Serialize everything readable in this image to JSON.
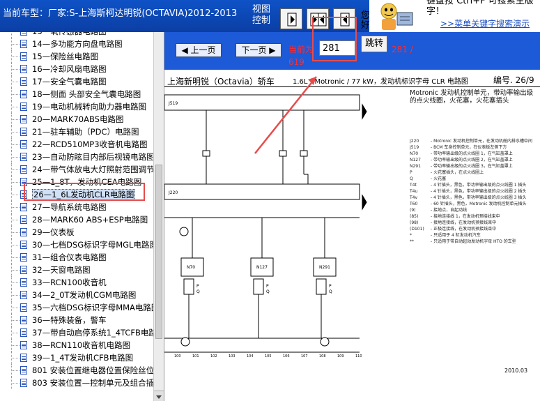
{
  "topbar": {
    "car_model": "当前车型：厂家:S-上海斯柯达明锐(OCTAVIA)2012-2013",
    "view_control_line1": "视图",
    "view_control_line2": "控制",
    "you_partial": "您好",
    "tip_line1": "键盘按   Ctrl+F   可搜索主版",
    "tip_line2": "字！",
    "tip_link": ">>菜单关键字搜索演示"
  },
  "sidebar": {
    "items": [
      {
        "label": "13—氧传感器电路图"
      },
      {
        "label": "14—多功能方向盘电路图"
      },
      {
        "label": "15—保险丝电路图"
      },
      {
        "label": "16—冷却风扇电路图"
      },
      {
        "label": "17—安全气囊电路图"
      },
      {
        "label": "18—侧面 头部安全气囊电路图"
      },
      {
        "label": "19—电动机械转向助力器电路图"
      },
      {
        "label": "20—MARK70ABS电路图"
      },
      {
        "label": "21—驻车辅助（PDC）电路图"
      },
      {
        "label": "22—RCD510MP3收音机电路图"
      },
      {
        "label": "23—自动防眩目内部后视镜电路图"
      },
      {
        "label": "24—带气体放电大灯照射范围调节"
      },
      {
        "label": "25—1_8T，发动机CEA电路图"
      },
      {
        "label": "26—1_6L发动机CLR电路图",
        "selected": true
      },
      {
        "label": "27—导航系统电路图"
      },
      {
        "label": "28—MARK60 ABS+ESP电路图"
      },
      {
        "label": "29—仪表板"
      },
      {
        "label": "30—七档DSG标识字母MGL电路图"
      },
      {
        "label": "31—组合仪表电路图"
      },
      {
        "label": "32—天窗电路图"
      },
      {
        "label": "33—RCN100收音机"
      },
      {
        "label": "34—2_0T发动机CGM电路图"
      },
      {
        "label": "35—六档DSG标识字母MMA电路图"
      },
      {
        "label": "36—特殊装备，警车"
      },
      {
        "label": "37—带自动启停系统1_4TCFB电路"
      },
      {
        "label": "38—RCN110收音机电路图"
      },
      {
        "label": "39—1_4T发动机CFB电路图"
      },
      {
        "label": "801 安装位置继电器位置保险丝位"
      },
      {
        "label": "803 安装位置—控制单元及组合插"
      }
    ]
  },
  "pager": {
    "prev_label": "上一页",
    "next_label": "下一页",
    "current_label": "当前为",
    "page_value": "281",
    "jump_label": "跳转",
    "page_of": "281 /",
    "total": "619"
  },
  "diagram": {
    "title": "上海新明锐（Octavia）轿车",
    "subtitle": "1.6L - Motronic / 77 kW，发动机标识字母 CLR 电路图",
    "code": "编号. 26/9",
    "description": "Motronic 发动机控制单元，带动率输出级的点火线圈，火花塞，火花塞插头",
    "date": "2010.03",
    "legend": [
      {
        "code": "J220",
        "text": "- Motronic 发动机控制单元，在发动机舱内排水槽中间"
      },
      {
        "code": "J519",
        "text": "- BCM 车身控制单元，在仪表板左侧下方"
      },
      {
        "code": "N70",
        "text": "- 带功率输出级的点火线圈 1，在气缸盖罩上"
      },
      {
        "code": "N127",
        "text": "- 带功率输出级的点火线圈 2，在气缸盖罩上"
      },
      {
        "code": "N291",
        "text": "- 带功率输出级的点火线圈 3，在气缸盖罩上"
      },
      {
        "code": "P",
        "text": "- 火花塞插头，在点火线圈上"
      },
      {
        "code": "Q",
        "text": "- 火花塞"
      },
      {
        "code": "T4t",
        "text": "- 4 针插头，黑色，带功率输出级的点火线圈 1 插头"
      },
      {
        "code": "T4u",
        "text": "- 4 针插头，黑色，带功率输出级的点火线圈 2 插头"
      },
      {
        "code": "T4v",
        "text": "- 4 针插头，黑色，带功率输出级的点火线圈 3 插头"
      },
      {
        "code": "T60",
        "text": "- 60 针插头，黑色，Motronic 发动机控制单元插头"
      },
      {
        "code": "(9)",
        "text": "- 接地点，自起动线"
      },
      {
        "code": "(85)",
        "text": "- 接地连接线 1，在发动机预接线束中"
      },
      {
        "code": "(98)",
        "text": "- 接地连接线，在发动机预接线束中"
      },
      {
        "code": "(D101)",
        "text": "- 正极连接线，在发动机预接线束中"
      },
      {
        "code": "*",
        "text": "- 只适用于 4 缸发动机汽车"
      },
      {
        "code": "**",
        "text": "- 只适用于带自动起动发动机字母 HTO 的车型"
      }
    ]
  }
}
